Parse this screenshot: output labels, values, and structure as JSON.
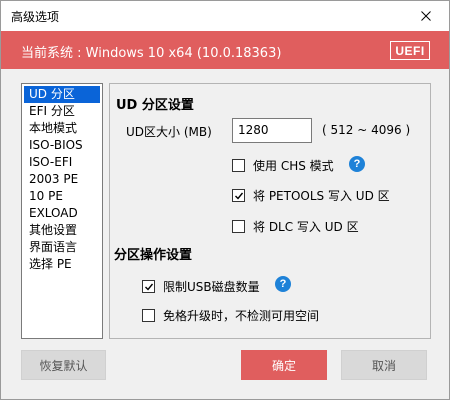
{
  "window": {
    "title": "高级选项",
    "close_label": "X"
  },
  "header": {
    "system_text": "当前系统 : Windows 10 x64 (10.0.18363)",
    "badge": "UEFI",
    "accent_color": "#e05e5e"
  },
  "sidebar": {
    "items": [
      {
        "label": "UD 分区",
        "selected": true
      },
      {
        "label": "EFI 分区"
      },
      {
        "label": "本地模式"
      },
      {
        "label": "ISO-BIOS"
      },
      {
        "label": "ISO-EFI"
      },
      {
        "label": "2003 PE"
      },
      {
        "label": "10 PE"
      },
      {
        "label": "EXLOAD"
      },
      {
        "label": "其他设置"
      },
      {
        "label": "界面语言"
      },
      {
        "label": "选择 PE"
      }
    ]
  },
  "ud_settings": {
    "title": "UD 分区设置",
    "size_label": "UD区大小 (MB)",
    "size_value": "1280",
    "size_range": "( 512 ~ 4096 )",
    "chs_mode": {
      "label": "使用 CHS 模式",
      "checked": false
    },
    "petools": {
      "label": "将 PETOOLS 写入 UD 区",
      "checked": true
    },
    "dlc": {
      "label": "将 DLC 写入 UD 区",
      "checked": false
    }
  },
  "partition_ops": {
    "title": "分区操作设置",
    "limit_usb": {
      "label": "限制USB磁盘数量",
      "checked": true
    },
    "skip_check": {
      "label": "免格升级时，不检测可用空间",
      "checked": false
    }
  },
  "buttons": {
    "restore": "恢复默认",
    "ok": "确定",
    "cancel": "取消"
  },
  "icons": {
    "help": "?"
  }
}
